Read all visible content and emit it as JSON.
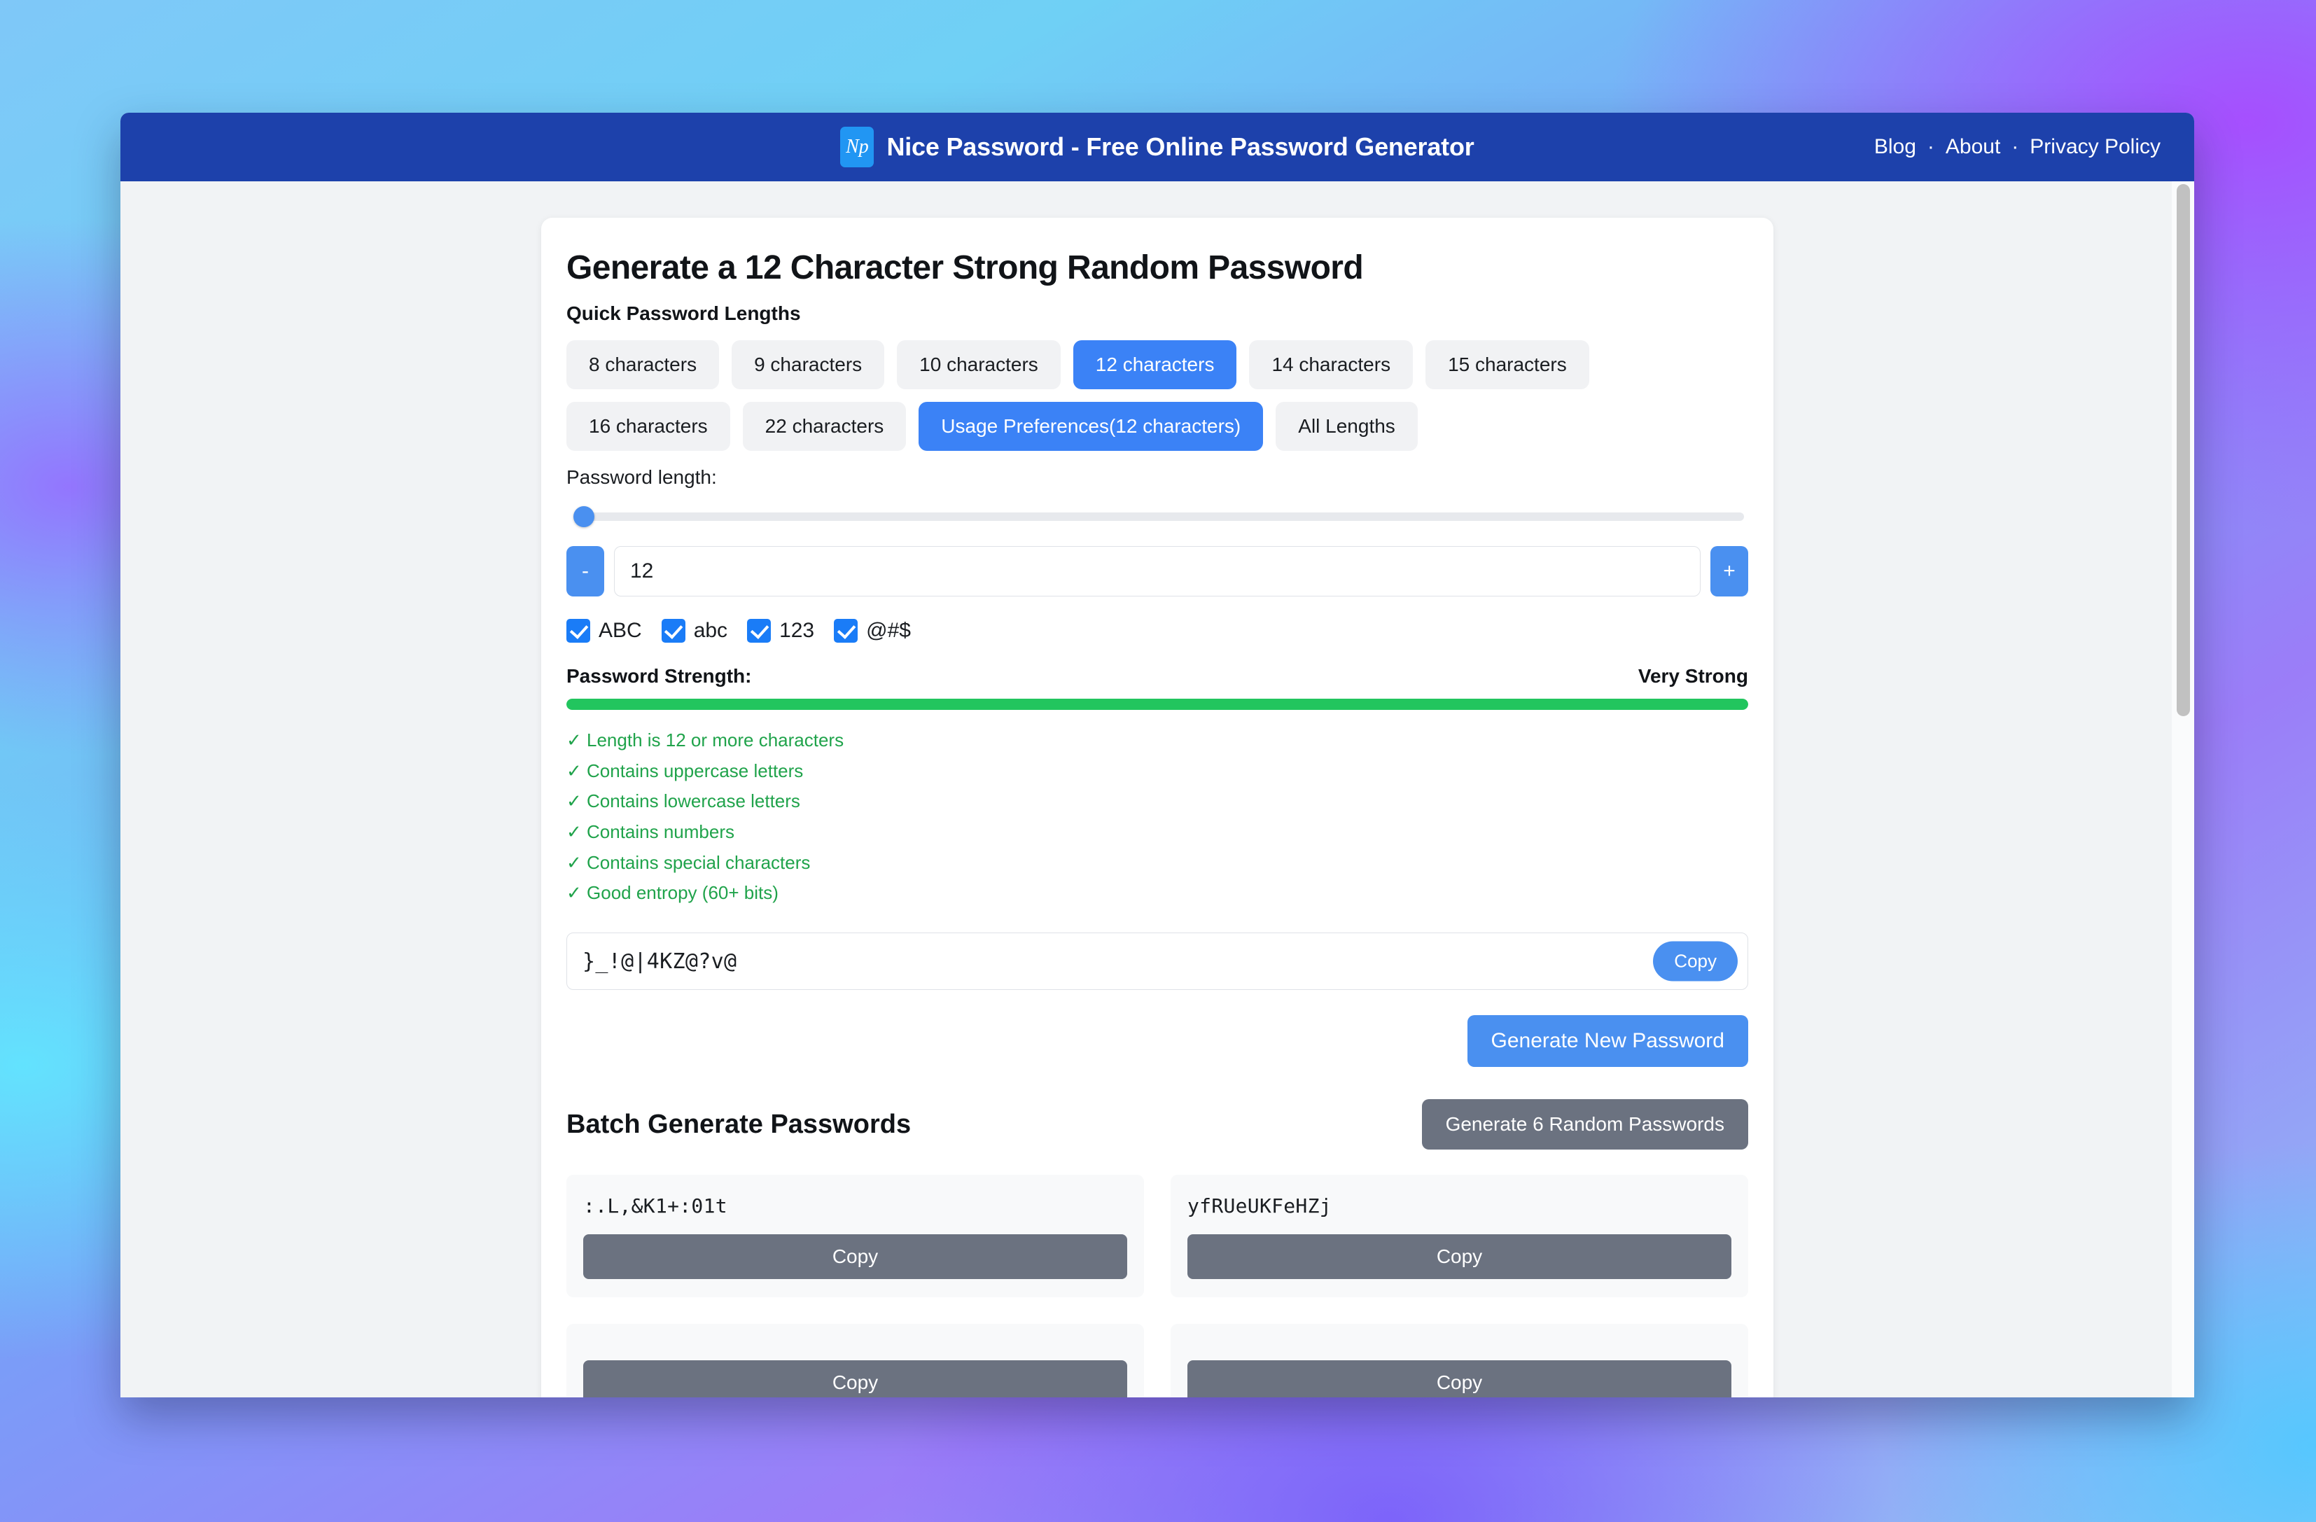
{
  "header": {
    "logo_text": "Np",
    "title": "Nice Password - Free Online Password Generator",
    "nav": [
      {
        "label": "Blog"
      },
      {
        "label": "About"
      },
      {
        "label": "Privacy Policy"
      }
    ],
    "nav_separator": "·"
  },
  "main": {
    "page_title": "Generate a 12 Character Strong Random Password",
    "quick_lengths_label": "Quick Password Lengths",
    "quick_lengths": [
      {
        "label": "8 characters",
        "active": false
      },
      {
        "label": "9 characters",
        "active": false
      },
      {
        "label": "10 characters",
        "active": false
      },
      {
        "label": "12 characters",
        "active": true
      },
      {
        "label": "14 characters",
        "active": false
      },
      {
        "label": "15 characters",
        "active": false
      },
      {
        "label": "16 characters",
        "active": false
      },
      {
        "label": "22 characters",
        "active": false
      },
      {
        "label": "Usage Preferences(12 characters)",
        "active": true
      },
      {
        "label": "All Lengths",
        "active": false
      }
    ],
    "password_length_label": "Password length:",
    "length_value": "12",
    "decrement_label": "-",
    "increment_label": "+",
    "charset_options": [
      {
        "label": "ABC",
        "checked": true
      },
      {
        "label": "abc",
        "checked": true
      },
      {
        "label": "123",
        "checked": true
      },
      {
        "label": "@#$",
        "checked": true
      }
    ],
    "strength_label": "Password Strength:",
    "strength_value": "Very Strong",
    "strength_percent": 100,
    "strength_color": "#22c55e",
    "criteria": [
      {
        "text": "✓ Length is 12 or more characters"
      },
      {
        "text": "✓ Contains uppercase letters"
      },
      {
        "text": "✓ Contains lowercase letters"
      },
      {
        "text": "✓ Contains numbers"
      },
      {
        "text": "✓ Contains special characters"
      },
      {
        "text": "✓ Good entropy (60+ bits)"
      }
    ],
    "generated_password": "}_!@|4KZ@?v@",
    "copy_label": "Copy",
    "generate_label": "Generate New Password"
  },
  "batch": {
    "title": "Batch Generate Passwords",
    "generate_label": "Generate 6 Random Passwords",
    "copy_label": "Copy",
    "passwords": [
      {
        "value": ":.L,&K1+:01t"
      },
      {
        "value": "yfRUeUKFeHZj"
      },
      {
        "value": ""
      },
      {
        "value": ""
      }
    ]
  },
  "colors": {
    "brand_header": "#1d41ab",
    "accent_blue": "#4a90f0",
    "active_chip": "#3b82f6",
    "checkbox_blue": "#1a7cf7",
    "strength_green": "#22c55e",
    "criteria_green": "#20a34b",
    "gray_button": "#6b7280"
  }
}
